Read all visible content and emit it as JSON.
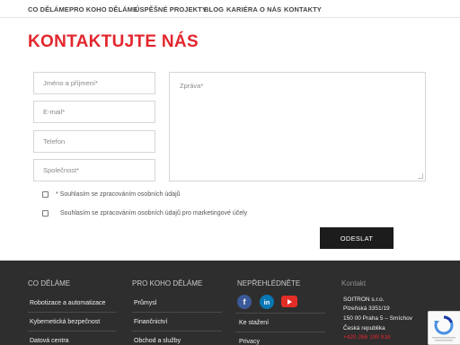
{
  "nav": {
    "items": [
      "CO DĚLÁME",
      "PRO KOHO DĚLÁME",
      "ÚSPĚŠNÉ PROJEKTY",
      "BLOG",
      "KARIÉRA",
      "O NÁS",
      "KONTAKTY"
    ]
  },
  "page": {
    "title": "KONTAKTUJTE NÁS"
  },
  "form": {
    "name_placeholder": "Jméno a příjmení*",
    "email_placeholder": "E-mail*",
    "phone_placeholder": "Telefon",
    "company_placeholder": "Společnost*",
    "message_placeholder": "Zpráva*",
    "consent_personal": "* Souhlasím se zpracováním osobních údajů",
    "consent_marketing": "Souhlasím se zpracováním osobních údajů pro marketingové účely",
    "submit_label": "ODESLAT"
  },
  "footer": {
    "col1": {
      "heading": "CO DĚLÁME",
      "items": [
        "Robotizace a automatizace",
        "Kybernetická bezpečnost",
        "Datová centra"
      ]
    },
    "col2": {
      "heading": "PRO KOHO DĚLÁME",
      "items": [
        "Průmysl",
        "Finančnictví",
        "Obchod a služby"
      ]
    },
    "col3": {
      "heading": "NEPŘEHLÉDNĚTE",
      "social": [
        "facebook-icon",
        "linkedin-icon",
        "youtube-icon"
      ],
      "items": [
        "Ke stažení",
        "Privacy"
      ]
    },
    "col4": {
      "heading": "Kontakt",
      "lines": [
        "SOITRON s.r.o.",
        "Plzeňská 3351/19",
        "150 00 Praha 5 – Smíchov",
        "Česká republika"
      ],
      "phone": "+420 266 199 918"
    }
  },
  "colors": {
    "accent": "#e3262d",
    "footer_bg": "#2e2e2e",
    "button_bg": "#1c1c1c"
  }
}
